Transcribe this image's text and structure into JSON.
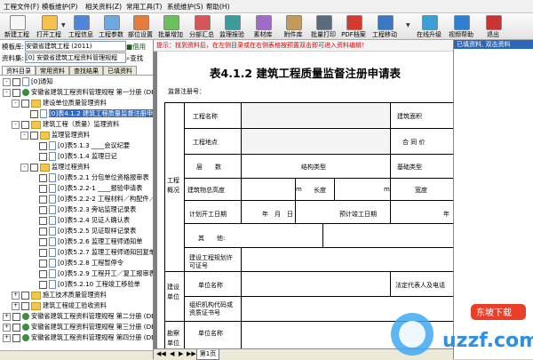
{
  "menu": [
    "工程文件(F)",
    "模板维护(P)",
    "相关资料(Z)",
    "常用工具(T)",
    "系统维护(S)",
    "帮助(H)"
  ],
  "toolbar": [
    {
      "label": "新建工程",
      "icon": "new-project-icon",
      "color": "#f7f7f7"
    },
    {
      "label": "打开工程",
      "icon": "open-folder-icon",
      "color": "#f2c14e"
    },
    {
      "label": "工程信息",
      "icon": "project-info-icon",
      "color": "#4f86d9"
    },
    {
      "label": "工程参数",
      "icon": "parameters-icon",
      "color": "#6fa7e0"
    },
    {
      "label": "部位设置",
      "icon": "location-icon",
      "color": "#e57b3c"
    },
    {
      "label": "批量增加",
      "icon": "batch-add-icon",
      "color": "#6cbf5c"
    },
    {
      "label": "分部汇总",
      "icon": "summary-icon",
      "color": "#d45656"
    },
    {
      "label": "监理报验",
      "icon": "inspection-icon",
      "color": "#3f9b9b"
    },
    {
      "label": "素材库",
      "icon": "material-library-icon",
      "color": "#a06bc7"
    },
    {
      "label": "附件库",
      "icon": "attachment-icon",
      "color": "#c29a5a"
    },
    {
      "label": "批量打印",
      "icon": "print-icon",
      "color": "#5a6b80"
    },
    {
      "label": "PDF档案",
      "icon": "pdf-icon",
      "color": "#d23c2e"
    },
    {
      "label": "工程移动",
      "icon": "move-project-icon",
      "color": "#3b78c2"
    },
    {
      "label": "在线升级",
      "icon": "upgrade-icon",
      "color": "#3aa0d8"
    },
    {
      "label": "视频帮助",
      "icon": "video-help-icon",
      "color": "#2e7fd1"
    },
    {
      "label": "退出",
      "icon": "exit-icon",
      "color": "#cc3333"
    }
  ],
  "left": {
    "template_label": "模板库:",
    "template_value": "安徽省建筑工程 (2011)",
    "borrow": "借用",
    "resource_label": "资料集:",
    "resource_value": "[0] 安徽省建筑工程资料管理规程",
    "find": "查找",
    "tabs": [
      "资料目录",
      "常用资料",
      "查找结果",
      "已填资料"
    ]
  },
  "tree": [
    {
      "text": "[0]通知",
      "indent": 0,
      "kind": "doc",
      "exp": "-"
    },
    {
      "text": "安徽省建筑工程资料管理规程 第一分册 (DB",
      "indent": 0,
      "kind": "globe",
      "exp": "-"
    },
    {
      "text": "建设单位质量管理资料",
      "indent": 1,
      "kind": "folder",
      "exp": "-"
    },
    {
      "text": "[0]表4.1.2 建筑工程质量监督注册申请",
      "indent": 2,
      "kind": "doc",
      "exp": "",
      "hl": true
    },
    {
      "text": "建筑工程（质量）监理资料",
      "indent": 1,
      "kind": "folder",
      "exp": "-"
    },
    {
      "text": "监理管理资料",
      "indent": 2,
      "kind": "folder",
      "exp": "-"
    },
    {
      "text": "[0]表5.1.3 ____会议纪要",
      "indent": 3,
      "kind": "doc",
      "exp": ""
    },
    {
      "text": "[0]表5.1.4 监理日记",
      "indent": 3,
      "kind": "doc",
      "exp": ""
    },
    {
      "text": "监理过程资料",
      "indent": 2,
      "kind": "folder",
      "exp": "-"
    },
    {
      "text": "[0]表5.2.1 分包单位资格报审表",
      "indent": 3,
      "kind": "doc",
      "exp": ""
    },
    {
      "text": "[0]表5.2.2-1 ____报验申请表",
      "indent": 3,
      "kind": "doc",
      "exp": ""
    },
    {
      "text": "[0]表5.2.2-2 工程材料／构配件／",
      "indent": 3,
      "kind": "doc",
      "exp": ""
    },
    {
      "text": "[0]表5.2.3 旁站监理记录表",
      "indent": 3,
      "kind": "doc",
      "exp": ""
    },
    {
      "text": "[0]表5.2.4 见证人确认表",
      "indent": 3,
      "kind": "doc",
      "exp": ""
    },
    {
      "text": "[0]表5.2.5 见证取样记录表",
      "indent": 3,
      "kind": "doc",
      "exp": ""
    },
    {
      "text": "[0]表5.2.6 监理工程师通知单",
      "indent": 3,
      "kind": "doc",
      "exp": ""
    },
    {
      "text": "[0]表5.2.7 监理工程师通知回复单",
      "indent": 3,
      "kind": "doc",
      "exp": ""
    },
    {
      "text": "[0]表5.2.8 工程暂停令",
      "indent": 3,
      "kind": "doc",
      "exp": ""
    },
    {
      "text": "[0]表5.2.9 工程开工／复工报审表",
      "indent": 3,
      "kind": "doc",
      "exp": ""
    },
    {
      "text": "[0]表5.2.10 工程竣工移验单",
      "indent": 3,
      "kind": "doc",
      "exp": ""
    },
    {
      "text": "施工技术质量管理资料",
      "indent": 1,
      "kind": "folder",
      "exp": "+"
    },
    {
      "text": "建筑工程竣工验收资料",
      "indent": 1,
      "kind": "folder",
      "exp": "+"
    },
    {
      "text": "安徽省建筑工程资料管理规程 第二分册 (DB",
      "indent": 0,
      "kind": "globe",
      "exp": "+"
    },
    {
      "text": "安徽省建筑工程资料管理规程 第三分册 (DB",
      "indent": 0,
      "kind": "globe",
      "exp": "+"
    },
    {
      "text": "安徽省建筑工程资料管理规程 第四分册 (DB",
      "indent": 0,
      "kind": "globe",
      "exp": "+"
    }
  ],
  "hint": "提示：找到资料后，在左侧目录或在右侧表格按预置双击即可进入资料编辑！",
  "form": {
    "title": "表4.1.2   建筑工程质量监督注册申请表",
    "reg_no": "监督注册号：",
    "section_project": "工程概况",
    "section_build": "建设单位",
    "section_survey": "勘察单位",
    "rows": {
      "name": "工程名称",
      "area": "建筑面积",
      "location": "工程地点",
      "contract": "合 同 价",
      "floors": "层　　数",
      "structure": "结构类型",
      "foundation": "基础类型",
      "height": "建筑物总高度",
      "m1": "m",
      "length": "长度",
      "m2": "m",
      "width": "宽度",
      "start": "计划开工日期",
      "ymd": "年　月　日",
      "end": "预计竣工日期",
      "year": "年",
      "other": "其　　他:",
      "permit": "建设工程规划许可证号",
      "unit_name": "单位名称",
      "legal": "法定代表人及电话",
      "org_code": "组织机构代码或资质证书号",
      "unit_name2": "单位名称"
    }
  },
  "page_tab": "第1页",
  "right_panel": {
    "header": "已填资料, 双击资料"
  },
  "watermark": {
    "text": "uzzf.com",
    "badge": "东坡下载"
  }
}
